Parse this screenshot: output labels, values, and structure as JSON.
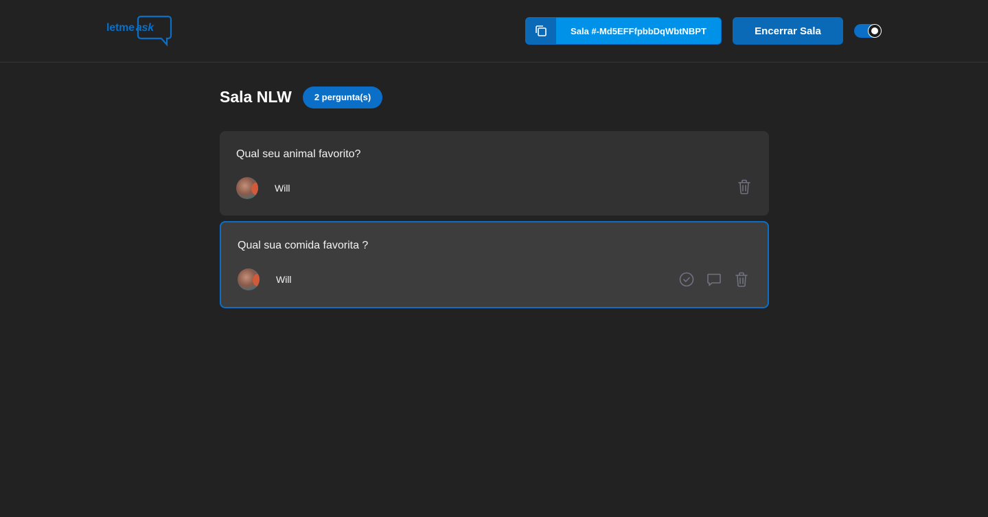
{
  "header": {
    "logo": {
      "text_main": "letme",
      "text_accent": "ask"
    },
    "room_code": {
      "label": "Sala #-Md5EFFfpbbDqWbtNBPT"
    },
    "close_room_label": "Encerrar Sala",
    "theme_toggle_on": true
  },
  "room": {
    "title": "Sala NLW",
    "question_count_label": "2 pergunta(s)"
  },
  "questions": [
    {
      "content": "Qual seu animal favorito?",
      "author": "Will",
      "actions": [
        "trash-icon"
      ]
    },
    {
      "content": "Qual sua comida favorita ?",
      "author": "Will",
      "actions": [
        "check-circle-icon",
        "chat-icon",
        "trash-icon"
      ]
    }
  ],
  "colors": {
    "background": "#222222",
    "accent": "#0b6fc7",
    "card": "#323232",
    "card_highlight": "#3d3d3d"
  }
}
